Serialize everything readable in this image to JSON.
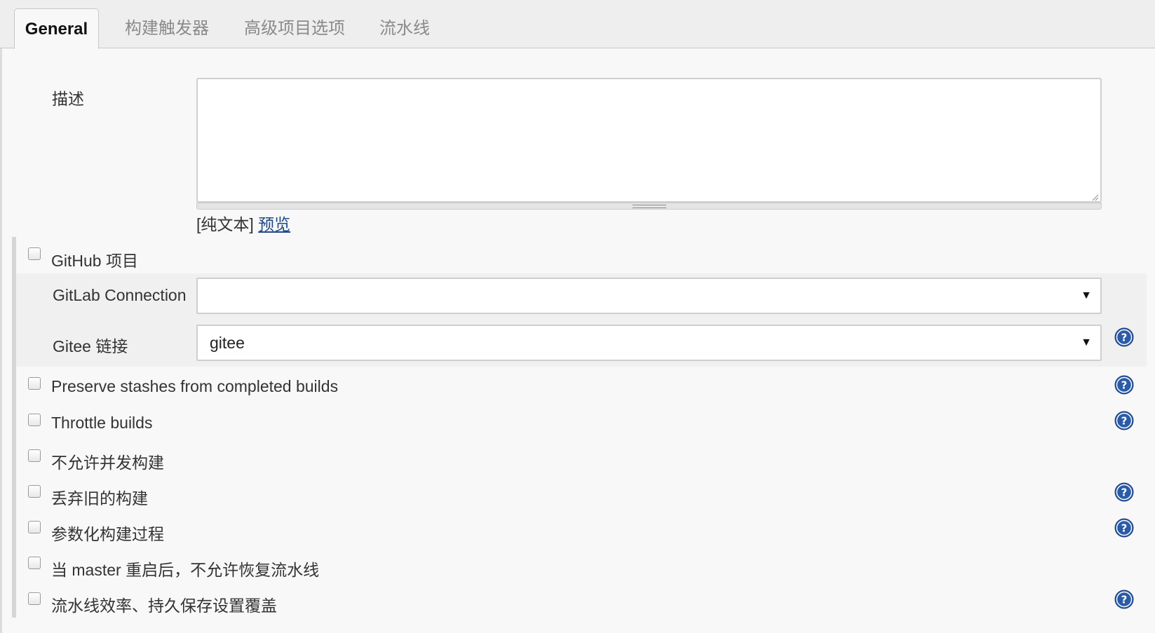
{
  "tabs": [
    {
      "label": "General",
      "active": true
    },
    {
      "label": "构建触发器",
      "active": false
    },
    {
      "label": "高级项目选项",
      "active": false
    },
    {
      "label": "流水线",
      "active": false
    }
  ],
  "description": {
    "label": "描述",
    "value": "",
    "format_prefix": "[纯文本]",
    "preview_link": "预览"
  },
  "github_project": {
    "label": "GitHub 项目",
    "checked": false
  },
  "gitlab_connection": {
    "label": "GitLab Connection",
    "value": ""
  },
  "gitee_link": {
    "label": "Gitee 链接",
    "value": "gitee"
  },
  "options": [
    {
      "label": "Preserve stashes from completed builds",
      "checked": false,
      "help": true
    },
    {
      "label": "Throttle builds",
      "checked": false,
      "help": true
    },
    {
      "label": "不允许并发构建",
      "checked": false,
      "help": false
    },
    {
      "label": "丢弃旧的构建",
      "checked": false,
      "help": true
    },
    {
      "label": "参数化构建过程",
      "checked": false,
      "help": true
    },
    {
      "label": "当 master 重启后，不允许恢复流水线",
      "checked": false,
      "help": false
    },
    {
      "label": "流水线效率、持久保存设置覆盖",
      "checked": false,
      "help": true
    }
  ],
  "colors": {
    "link": "#204a87",
    "help_icon": "#2a5ba6",
    "tab_active_text": "#111111",
    "tab_inactive_text": "#8a8a8a"
  },
  "icons": {
    "help": "help-question-icon",
    "dropdown": "caret-down-icon"
  }
}
